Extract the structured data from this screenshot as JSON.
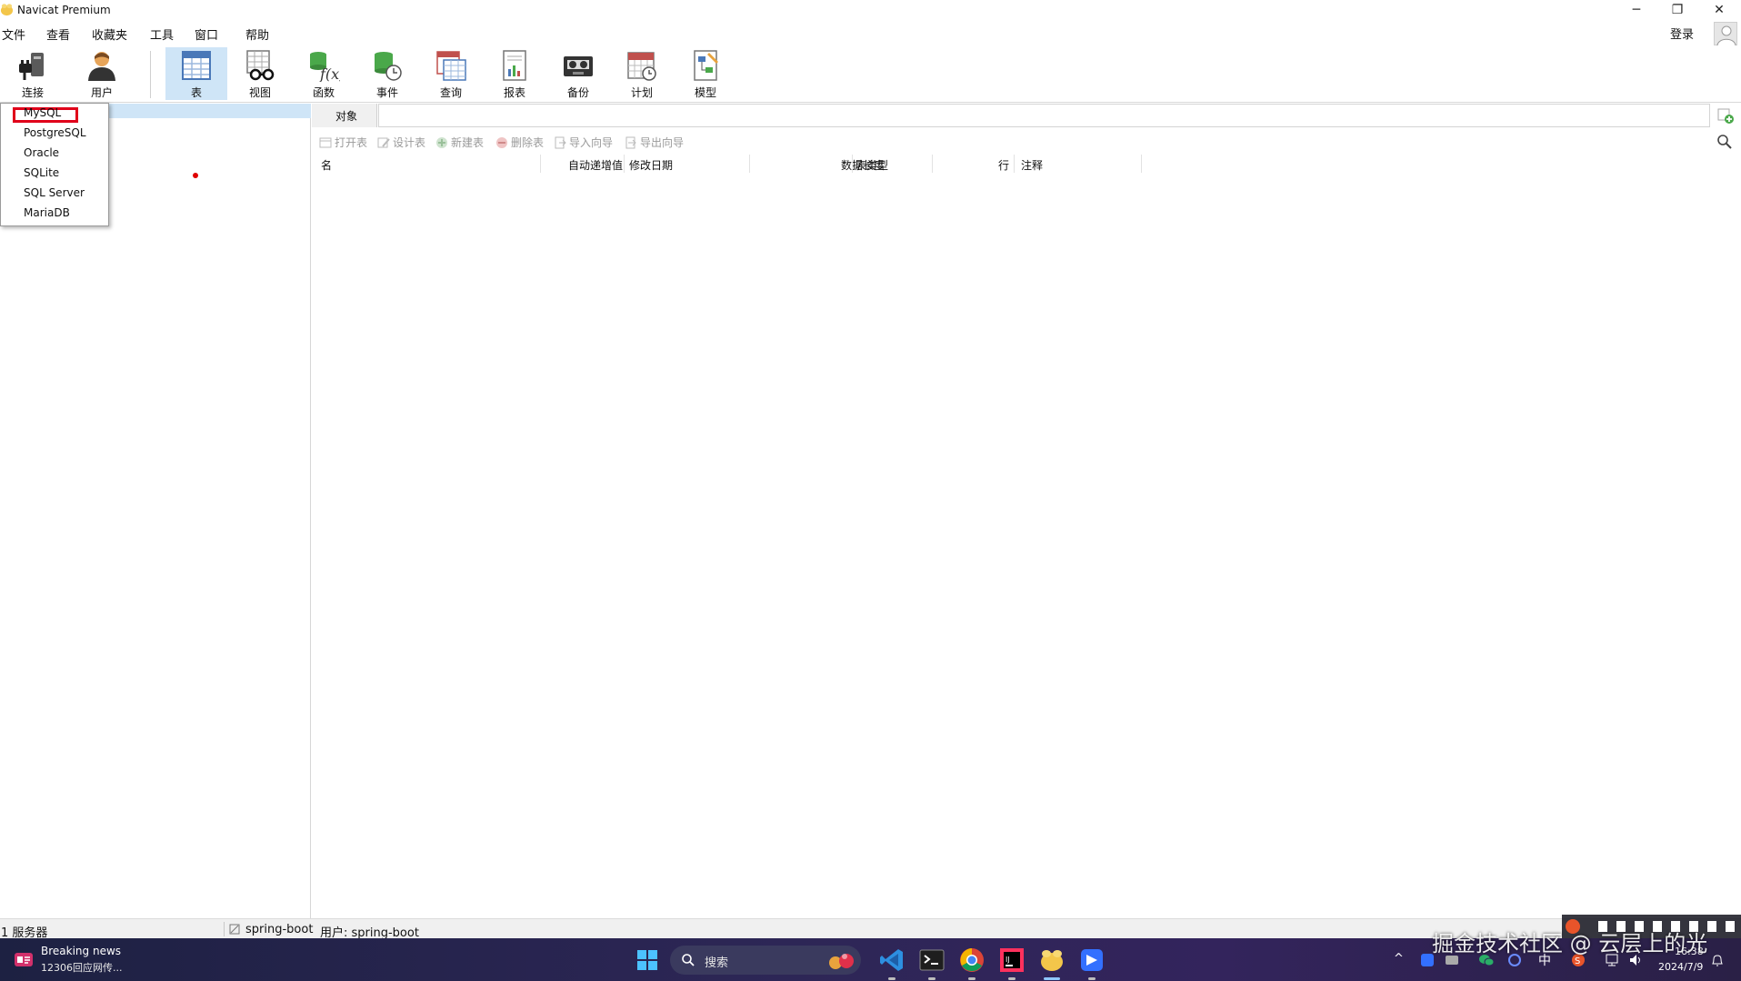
{
  "window": {
    "title": "Navicat Premium",
    "minimize_glyph": "─",
    "restore_glyph": "❐",
    "close_glyph": "✕"
  },
  "menu": [
    "文件",
    "查看",
    "收藏夹",
    "工具",
    "窗口",
    "帮助"
  ],
  "login_label": "登录",
  "toolbar": {
    "connect": "连接",
    "user": "用户",
    "table": "表",
    "view": "视图",
    "function": "函数",
    "event": "事件",
    "query": "查询",
    "report": "报表",
    "backup": "备份",
    "schedule": "计划",
    "model": "模型",
    "active_tool": "表"
  },
  "connection_menu": {
    "items": [
      "MySQL",
      "PostgreSQL",
      "Oracle",
      "SQLite",
      "SQL Server",
      "MariaDB"
    ],
    "highlighted": "MySQL",
    "highlight_color": "#e0001a"
  },
  "object_tab": "对象",
  "object_filter_value": "",
  "actions": [
    "打开表",
    "设计表",
    "新建表",
    "删除表",
    "导入向导",
    "导出向导"
  ],
  "table_columns": [
    "名",
    "自动递增值",
    "修改日期",
    "数据长度",
    "表类型",
    "行",
    "注释"
  ],
  "status": {
    "servers": "1 服务器",
    "connection": "spring-boot",
    "user": "用户: spring-boot"
  },
  "taskbar": {
    "news_title": "Breaking news",
    "news_sub": "12306回应网传...",
    "search_placeholder": "搜索",
    "apps": [
      "vscode-icon",
      "terminal-icon",
      "chrome-icon",
      "intellij-icon",
      "navicat-icon",
      "feishu-icon"
    ],
    "ime_label": "中",
    "time": "16:38",
    "date": "2024/7/9"
  },
  "watermark": "掘金技术社区 @ 云层上的光",
  "colors": {
    "selection": "#cfe5f7",
    "taskbar": "#2d2656"
  }
}
